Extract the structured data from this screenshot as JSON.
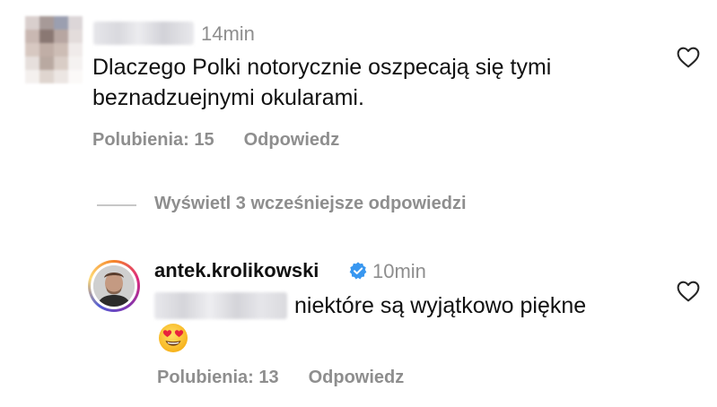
{
  "comment": {
    "time": "14min",
    "text": "Dlaczego Polki notorycznie oszpecają się tymi beznadzuejnymi okularami.",
    "likes_label": "Polubienia: 15",
    "reply_label": "Odpowiedz",
    "like_icon": "heart-outline-icon"
  },
  "view_replies": {
    "label": "Wyświetl 3 wcześniejsze odpowiedzi"
  },
  "reply": {
    "username": "antek.krolikowski",
    "verified_icon": "verified-badge-icon",
    "time": "10min",
    "text": "niektóre są wyjątkowo piękne",
    "emoji": "heart-eyes-emoji",
    "likes_label": "Polubienia: 13",
    "reply_label": "Odpowiedz",
    "like_icon": "heart-outline-icon"
  },
  "colors": {
    "text": "#111111",
    "muted": "#8e8e8e",
    "verified": "#3897f0",
    "divider": "#c7c7c7"
  }
}
